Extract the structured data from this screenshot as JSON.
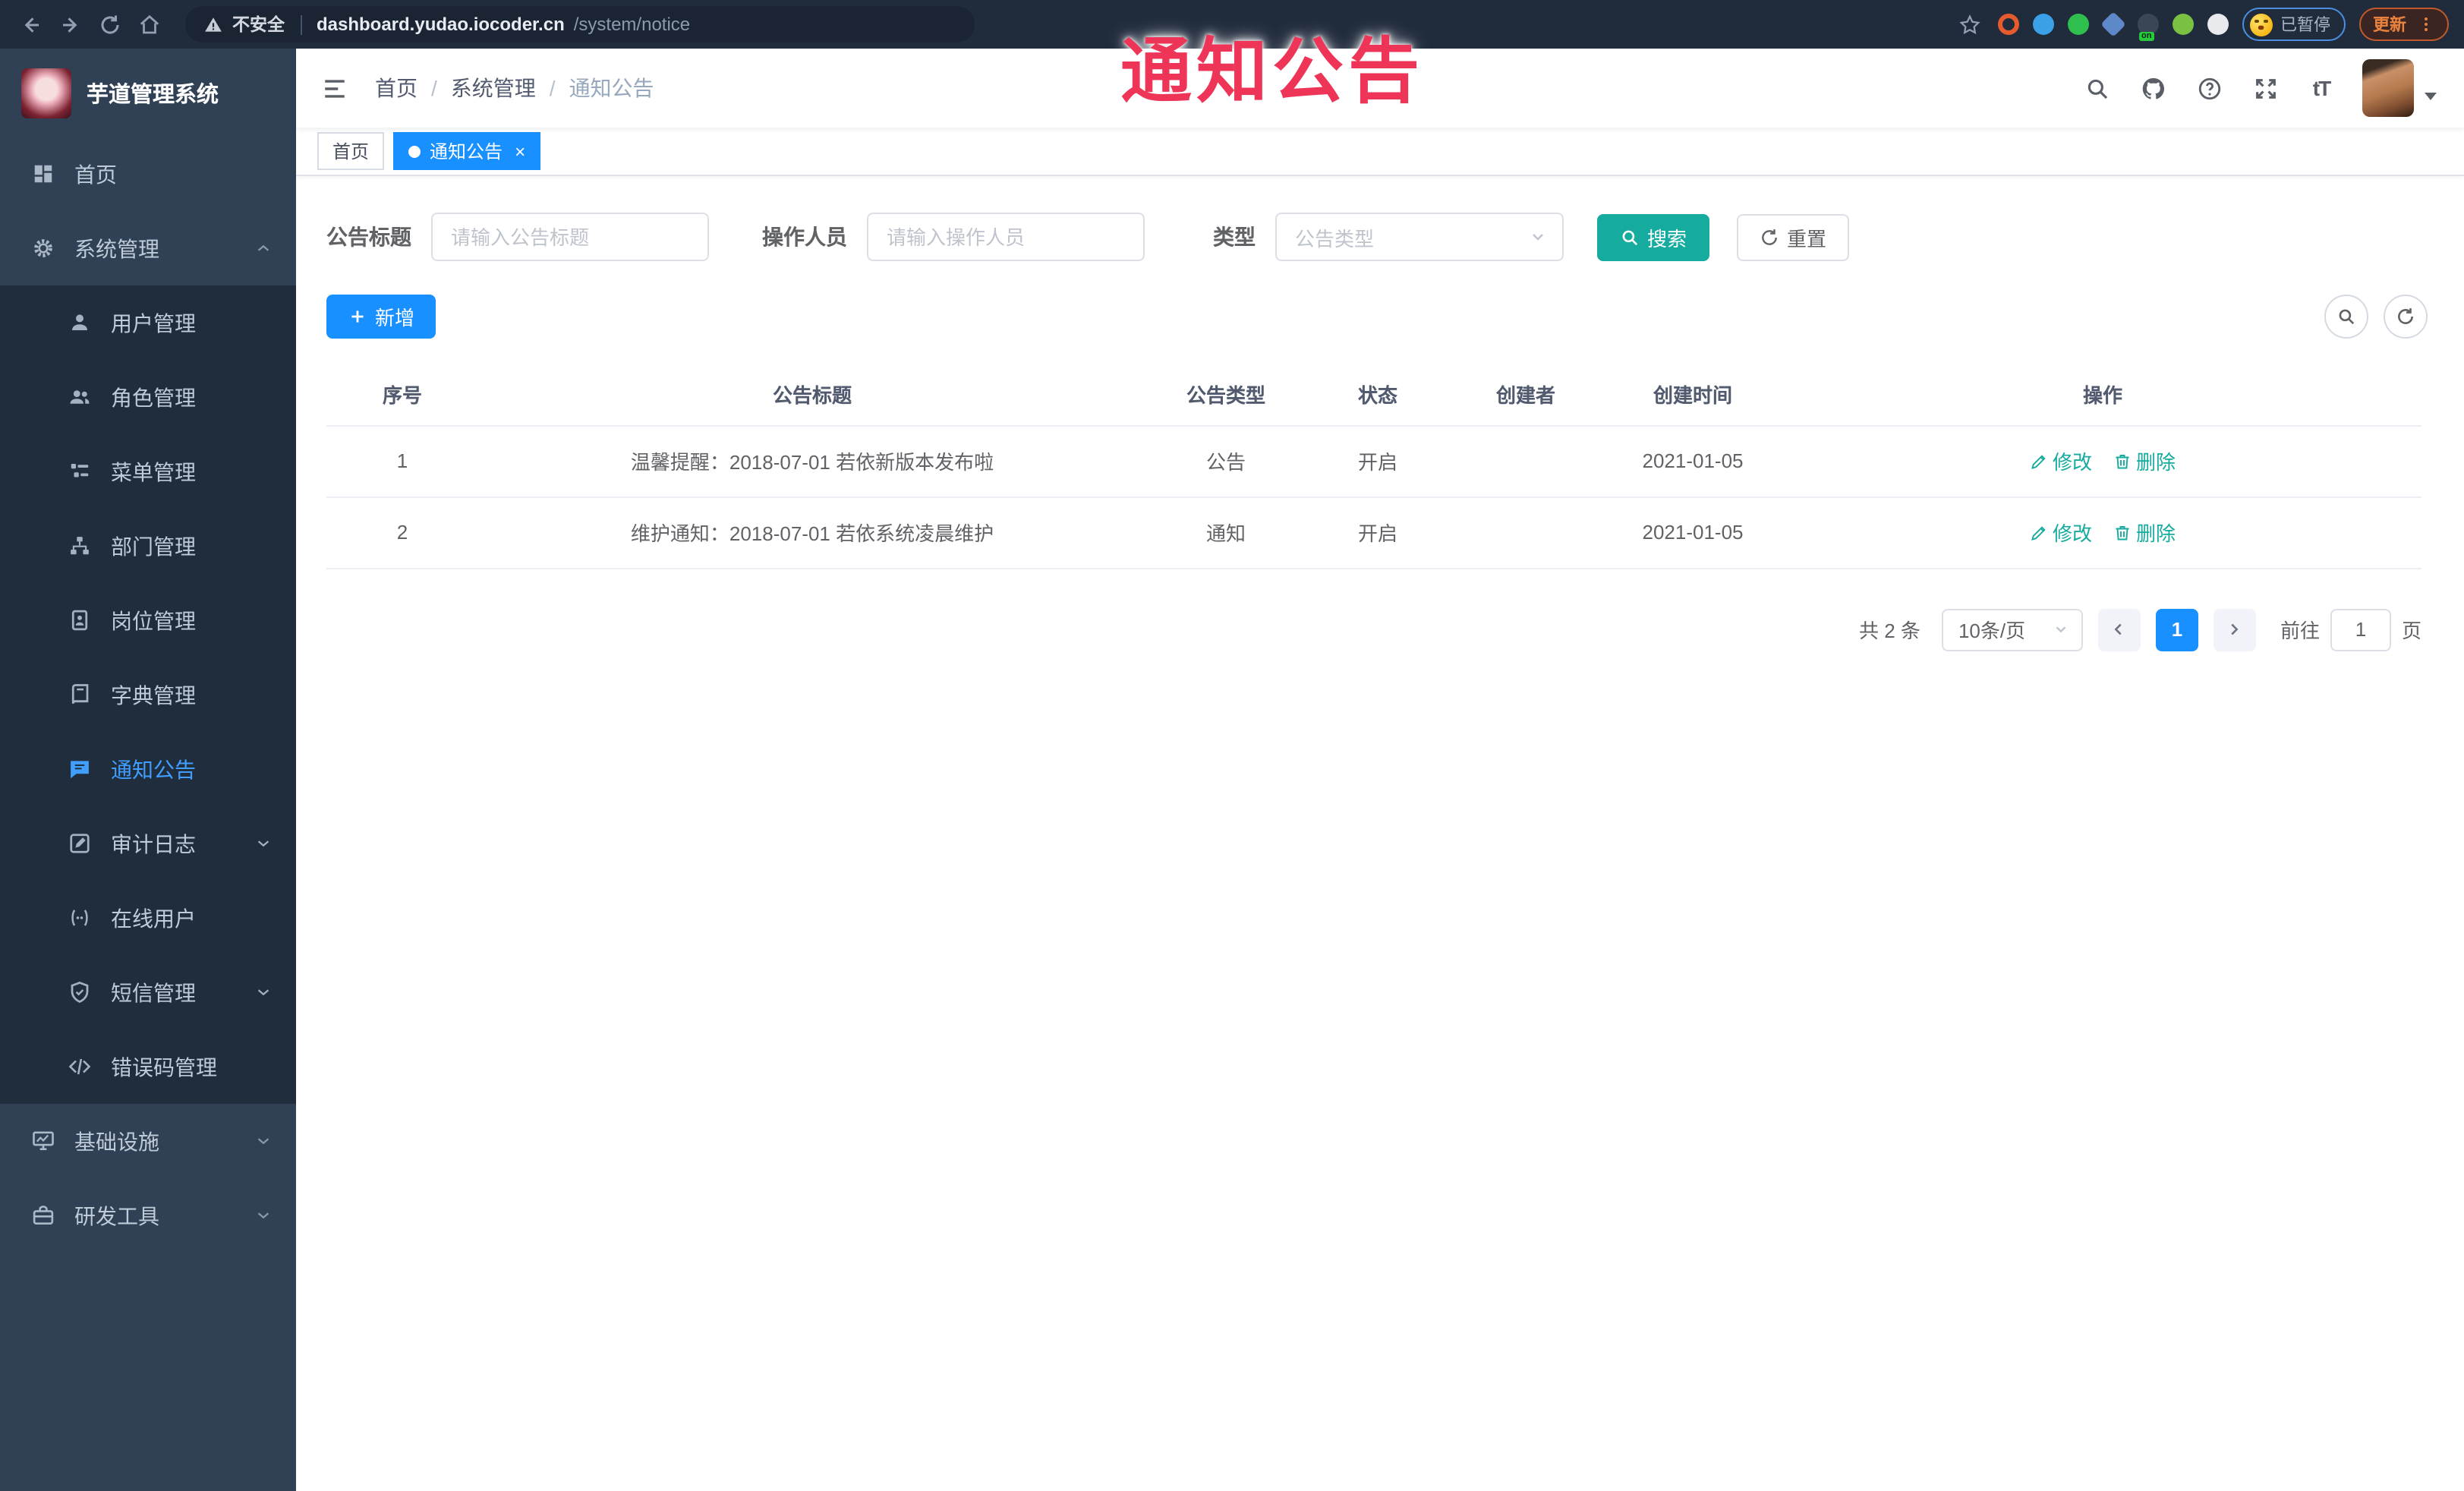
{
  "browser": {
    "security_warning": "不安全",
    "url_host": "dashboard.yudao.iocoder.cn",
    "url_path": "/system/notice",
    "paused_label": "已暂停",
    "update_label": "更新",
    "extensions": [
      {
        "name": "orange-ring-extension-icon",
        "color": "#e55b2d",
        "ring": true
      },
      {
        "name": "blue-drop-extension-icon",
        "color": "#3aa0e8"
      },
      {
        "name": "green-circle-extension-icon",
        "color": "#2fbf4f"
      },
      {
        "name": "blue-diamond-extension-icon",
        "color": "#5e89c8"
      },
      {
        "name": "dark-on-badge-extension-icon",
        "color": "#3a4556",
        "badge": "on"
      },
      {
        "name": "green-leaf-extension-icon",
        "color": "#7ac143"
      },
      {
        "name": "puzzle-extension-icon",
        "color": "#e8eaed"
      }
    ]
  },
  "overlay": {
    "text": "通知公告",
    "color": "#ee3558"
  },
  "sidebar": {
    "title": "芋道管理系统",
    "items": [
      {
        "label": "首页",
        "icon": "dashboard-icon",
        "level": 1
      },
      {
        "label": "系统管理",
        "icon": "gear-icon",
        "level": 1,
        "chevron": "up"
      },
      {
        "label": "用户管理",
        "icon": "user-icon",
        "level": 2
      },
      {
        "label": "角色管理",
        "icon": "users-icon",
        "level": 2
      },
      {
        "label": "菜单管理",
        "icon": "menu-tree-icon",
        "level": 2
      },
      {
        "label": "部门管理",
        "icon": "org-icon",
        "level": 2
      },
      {
        "label": "岗位管理",
        "icon": "badge-icon",
        "level": 2
      },
      {
        "label": "字典管理",
        "icon": "dict-icon",
        "level": 2
      },
      {
        "label": "通知公告",
        "icon": "message-icon",
        "level": 2,
        "active": true
      },
      {
        "label": "审计日志",
        "icon": "log-icon",
        "level": 2,
        "chevron": "down"
      },
      {
        "label": "在线用户",
        "icon": "online-icon",
        "level": 2
      },
      {
        "label": "短信管理",
        "icon": "shield-icon",
        "level": 2,
        "chevron": "down"
      },
      {
        "label": "错误码管理",
        "icon": "code-icon",
        "level": 2
      },
      {
        "label": "基础设施",
        "icon": "infra-icon",
        "level": 1,
        "chevron": "down"
      },
      {
        "label": "研发工具",
        "icon": "tool-icon",
        "level": 1,
        "chevron": "down"
      }
    ]
  },
  "header": {
    "breadcrumb": [
      "首页",
      "系统管理",
      "通知公告"
    ]
  },
  "tags": [
    {
      "label": "首页",
      "active": false
    },
    {
      "label": "通知公告",
      "active": true,
      "closable": true
    }
  ],
  "filters": {
    "title_label": "公告标题",
    "title_placeholder": "请输入公告标题",
    "operator_label": "操作人员",
    "operator_placeholder": "请输入操作人员",
    "type_label": "类型",
    "type_placeholder": "公告类型",
    "search_label": "搜索",
    "reset_label": "重置"
  },
  "toolbar": {
    "add_label": "新增"
  },
  "table": {
    "columns": [
      "序号",
      "公告标题",
      "公告类型",
      "状态",
      "创建者",
      "创建时间",
      "操作"
    ],
    "edit_label": "修改",
    "delete_label": "删除",
    "rows": [
      {
        "no": "1",
        "title": "温馨提醒：2018-07-01 若依新版本发布啦",
        "type": "公告",
        "status": "开启",
        "creator": "",
        "created": "2021-01-05"
      },
      {
        "no": "2",
        "title": "维护通知：2018-07-01 若依系统凌晨维护",
        "type": "通知",
        "status": "开启",
        "creator": "",
        "created": "2021-01-05"
      }
    ]
  },
  "pagination": {
    "total": "共 2 条",
    "page_size": "10条/页",
    "current": "1",
    "goto_label": "前往",
    "goto_value": "1",
    "page_label": "页"
  },
  "colors": {
    "primary_blue": "#1890ff",
    "link_blue": "#409eff",
    "teal_action": "#16ab9f",
    "sidebar_bg": "#304156",
    "submenu_bg": "#1f2d3d",
    "chrome_bg": "#202b3c",
    "overlay_red": "#ee3558"
  }
}
